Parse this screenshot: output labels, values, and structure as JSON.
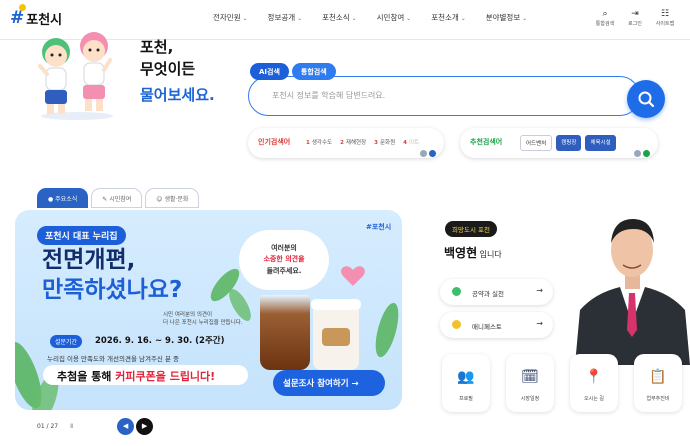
{
  "header": {
    "logo_mark": "#",
    "logo_name": "포천시",
    "nav": [
      "전자민원",
      "정보공개",
      "포천소식",
      "시민참여",
      "포천소개",
      "분야별정보"
    ],
    "utilities": [
      {
        "icon": "search-icon",
        "glyph": "⌕",
        "label": "통합검색"
      },
      {
        "icon": "login-icon",
        "glyph": "⇥",
        "label": "로그인"
      },
      {
        "icon": "sitemap-icon",
        "glyph": "☷",
        "label": "사이트맵"
      }
    ]
  },
  "hero": {
    "title_line1": "포천,",
    "title_line2": "무엇이든",
    "title_line3": "물어보세요.",
    "search_tab_ai": "AI검색",
    "search_tab_integrated": "통합검색",
    "search_placeholder": "포천시 정보를 학습해 답변드려요.",
    "popular_label": "인기검색어",
    "popular": [
      {
        "rank": "1",
        "text": "생각수도"
      },
      {
        "rank": "2",
        "text": "재해현장"
      },
      {
        "rank": "3",
        "text": "문화원"
      },
      {
        "rank": "4",
        "text": "이트"
      }
    ],
    "recommend_label": "추천검색어",
    "recommend": [
      "어드벤처",
      "캠핑장",
      "체육시설"
    ]
  },
  "tabs": [
    "주요소식",
    "시민참여",
    "생활·문화"
  ],
  "banner": {
    "brand": "#포천시",
    "tag": "포천시 대표 누리집",
    "headline1": "전면개편,",
    "headline2": "만족하셨나요?",
    "sub1": "시민 여러분의 의견이",
    "sub2": "더 나은 포천시 누리집을 만듭니다.",
    "bubble1": "여러분의",
    "bubble2": "소중한 의견을",
    "bubble3": "들려주세요.",
    "period_tag": "설문기간",
    "period": "2026. 9. 16. ~ 9. 30. (2주간)",
    "note": "누리집 이용 만족도와 개선의견을 남겨주신 분 중",
    "coupon_pre": "추첨을 통해 ",
    "coupon_hl": "커피쿠폰을 드립니다!",
    "survey_button": "설문조사 참여하기 →",
    "slide_count": "01 / 27",
    "pause": "Ⅱ"
  },
  "mayor": {
    "tag": "희망도시 포천",
    "name": "백영현",
    "suffix": " 입니다",
    "links": [
      {
        "label": "공약과 실천",
        "color": "#3bbf6b",
        "arrow": "→"
      },
      {
        "label": "매니페스토",
        "color": "#f2c12e",
        "arrow": "→"
      }
    ],
    "quick": [
      {
        "label": "프로필",
        "glyph": "👥"
      },
      {
        "label": "시장일정",
        "glyph": "🗓"
      },
      {
        "label": "오시는 길",
        "glyph": "📍"
      },
      {
        "label": "업무추진비",
        "glyph": "📋"
      }
    ]
  },
  "colors": {
    "accent": "#1d64d6",
    "dark": "#102e6b",
    "highlight": "#e0243b"
  }
}
